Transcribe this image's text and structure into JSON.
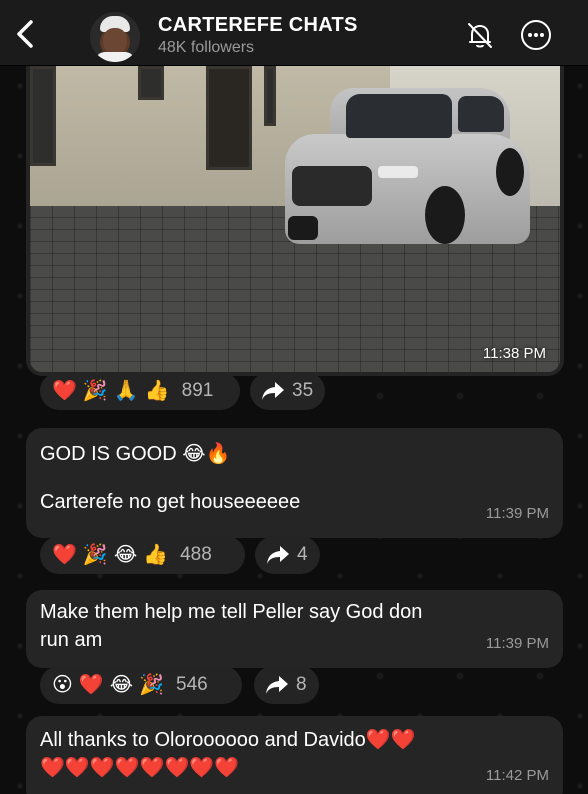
{
  "header": {
    "back_icon": "chevron-left-icon",
    "channel_name": "CARTEREFE CHATS",
    "followers": "48K followers",
    "mute_icon": "bell-off-icon",
    "more_icon": "ellipsis-circle-icon"
  },
  "messages": [
    {
      "type": "photo",
      "time": "11:38 PM",
      "reactions": [
        "❤️",
        "🎉",
        "🙏",
        "👍"
      ],
      "reaction_count": "891",
      "forward_count": "35"
    },
    {
      "type": "text",
      "line1": "GOD IS GOOD 😂🔥",
      "line2": "Carterefe no get houseeeeee",
      "time": "11:39 PM",
      "reactions": [
        "❤️",
        "🎉",
        "😂",
        "👍"
      ],
      "reaction_count": "488",
      "forward_count": "4"
    },
    {
      "type": "text",
      "line1": "Make them help me tell Peller say God don",
      "line2": "run am",
      "time": "11:39 PM",
      "reactions": [
        "😮",
        "❤️",
        "😂",
        "🎉"
      ],
      "reaction_count": "546",
      "forward_count": "8"
    },
    {
      "type": "text",
      "line1": "All thanks to Oloroooooo and Davido❤️❤️",
      "line2": "❤️❤️❤️❤️❤️❤️❤️❤️",
      "time": "11:42 PM"
    }
  ],
  "colors": {
    "background": "#0b0b0b",
    "header": "#1b1b1b",
    "bubble": "#252525",
    "muted_text": "#9a9a9a"
  }
}
